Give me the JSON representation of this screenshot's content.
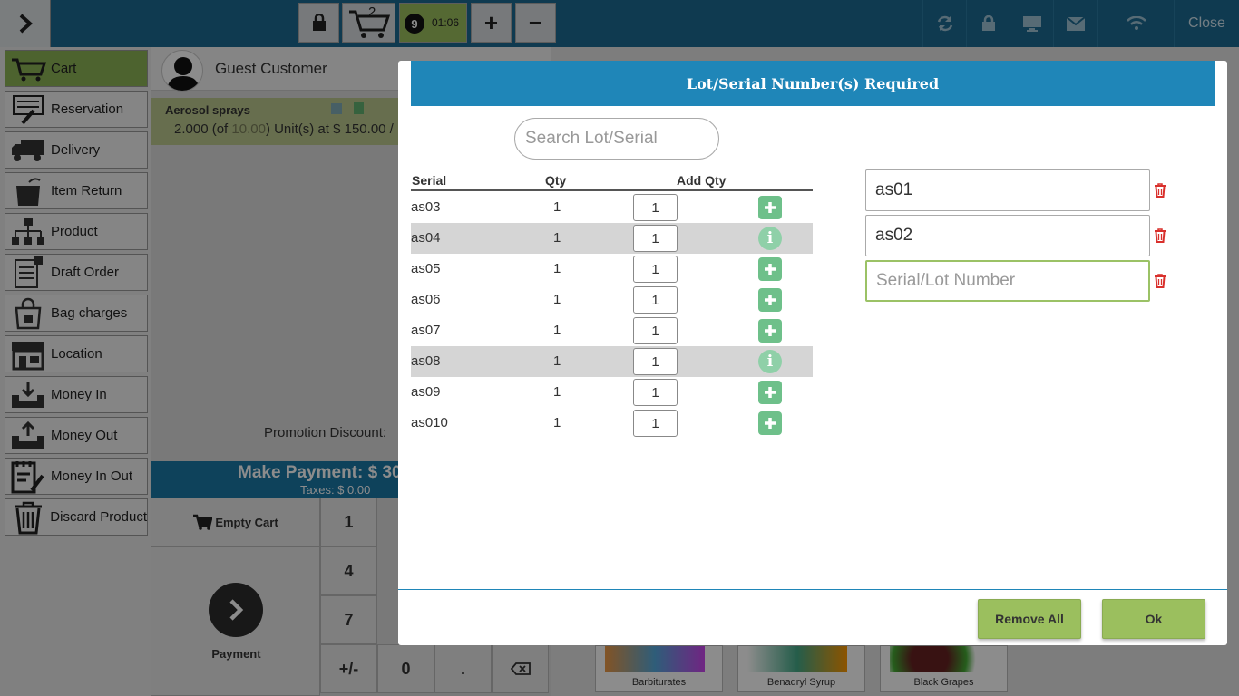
{
  "topbar": {
    "cart_count": "2",
    "timer_badge": "9",
    "timer": "01:06",
    "plus": "+",
    "minus": "−",
    "close": "Close"
  },
  "sidebar": {
    "items": [
      {
        "label": "Cart",
        "icon": "cart-icon",
        "active": true
      },
      {
        "label": "Reservation",
        "icon": "reservation-icon"
      },
      {
        "label": "Delivery",
        "icon": "delivery-truck-icon"
      },
      {
        "label": "Item Return",
        "icon": "item-return-icon"
      },
      {
        "label": "Product",
        "icon": "product-hierarchy-icon"
      },
      {
        "label": "Draft Order",
        "icon": "draft-order-icon"
      },
      {
        "label": "Bag charges",
        "icon": "bag-icon"
      },
      {
        "label": "Location",
        "icon": "store-icon"
      },
      {
        "label": "Money In",
        "icon": "money-in-icon"
      },
      {
        "label": "Money Out",
        "icon": "money-out-icon"
      },
      {
        "label": "Money In Out",
        "icon": "money-in-out-icon"
      },
      {
        "label": "Discard Product",
        "icon": "trash-icon"
      }
    ]
  },
  "customer": {
    "name": "Guest Customer"
  },
  "cart_line": {
    "name": "Aerosol sprays",
    "detail_prefix": "2.000 (of ",
    "detail_of": "10.00",
    "detail_suffix": ") Unit(s) at $ 150.00 /"
  },
  "promotion_label": "Promotion Discount:",
  "payment": {
    "make_payment": "Make Payment: $ 30",
    "taxes": "Taxes: $ 0.00",
    "empty_cart": "Empty Cart",
    "pay_label": "Payment"
  },
  "keypad": {
    "k1": "1",
    "k4": "4",
    "k7": "7",
    "kpm": "+/-",
    "k0": "0",
    "kdot": "."
  },
  "products": [
    {
      "name": "Barbiturates"
    },
    {
      "name": "Benadryl Syrup"
    },
    {
      "name": "Black Grapes"
    }
  ],
  "modal": {
    "title": "Lot/Serial Number(s) Required",
    "search_placeholder": "Search Lot/Serial",
    "columns": {
      "serial": "Serial",
      "qty": "Qty",
      "add_qty": "Add Qty"
    },
    "rows": [
      {
        "serial": "as03",
        "qty": "1",
        "add": "1",
        "action": "add"
      },
      {
        "serial": "as04",
        "qty": "1",
        "add": "1",
        "action": "info"
      },
      {
        "serial": "as05",
        "qty": "1",
        "add": "1",
        "action": "add"
      },
      {
        "serial": "as06",
        "qty": "1",
        "add": "1",
        "action": "add"
      },
      {
        "serial": "as07",
        "qty": "1",
        "add": "1",
        "action": "add"
      },
      {
        "serial": "as08",
        "qty": "1",
        "add": "1",
        "action": "info"
      },
      {
        "serial": "as09",
        "qty": "1",
        "add": "1",
        "action": "add"
      },
      {
        "serial": "as010",
        "qty": "1",
        "add": "1",
        "action": "add"
      }
    ],
    "selected_serials": [
      "as01",
      "as02"
    ],
    "new_serial_placeholder": "Serial/Lot Number",
    "remove_all": "Remove All",
    "ok": "Ok"
  },
  "colors": {
    "header_blue": "#1f86b8",
    "topbar_blue": "#1c6a92",
    "accent_green": "#9bbf5e",
    "add_green": "#6ec08a",
    "delete_red": "#d9302c"
  }
}
